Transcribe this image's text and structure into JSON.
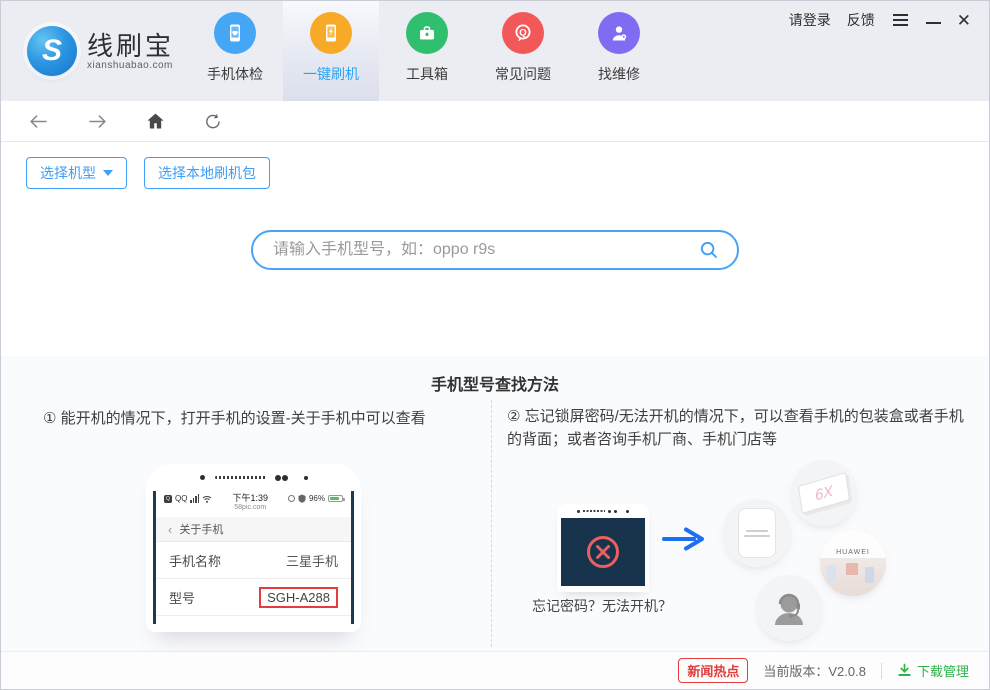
{
  "titlebar": {
    "login_label": "请登录",
    "feedback_label": "反馈"
  },
  "header": {
    "logo_title": "线刷宝",
    "logo_letter": "S",
    "logo_subtitle": "xianshuabao.com",
    "nav": [
      {
        "label": "手机体检"
      },
      {
        "label": "一键刷机"
      },
      {
        "label": "工具箱"
      },
      {
        "label": "常见问题"
      },
      {
        "label": "找维修"
      }
    ]
  },
  "actions": {
    "select_model_label": "选择机型",
    "select_local_package_label": "选择本地刷机包"
  },
  "search": {
    "placeholder": "请输入手机型号，如：oppo r9s"
  },
  "help": {
    "title": "手机型号查找方法",
    "left": {
      "instruction": "① 能开机的情况下，打开手机的设置-关于手机中可以查看",
      "phone": {
        "carrier": "QQ",
        "qq_badge": "Q",
        "time": "下午1:39",
        "site": "58pic.com",
        "battery": "96%",
        "back_icon": "‹",
        "nav_title": "关于手机",
        "rows": [
          {
            "label": "手机名称",
            "value": "三星手机"
          },
          {
            "label": "型号",
            "value": "SGH-A288"
          }
        ]
      }
    },
    "right": {
      "instruction": "② 忘记锁屏密码/无法开机的情况下，可以查看手机的包装盒或者手机的背面；或者咨询手机厂商、手机门店等",
      "locked_phone_label": "忘记密码？无法开机？",
      "box_text": "6X",
      "store_text": "HUAWEI"
    }
  },
  "footer": {
    "news_label": "新闻热点",
    "version_label": "当前版本：V2.0.8",
    "download_label": "下载管理"
  },
  "colors": {
    "accent_blue": "#3f9ef5",
    "active_nav_text": "#2aa3f7",
    "badge_red": "#e23c3c",
    "download_green": "#2cb34a",
    "nav_icon_blue": "#45a6f6",
    "nav_icon_orange": "#f7a928",
    "nav_icon_green": "#30bf6f",
    "nav_icon_red": "#f25858",
    "nav_icon_purple": "#7e6df0",
    "phone_screen_navy": "#18344c"
  }
}
